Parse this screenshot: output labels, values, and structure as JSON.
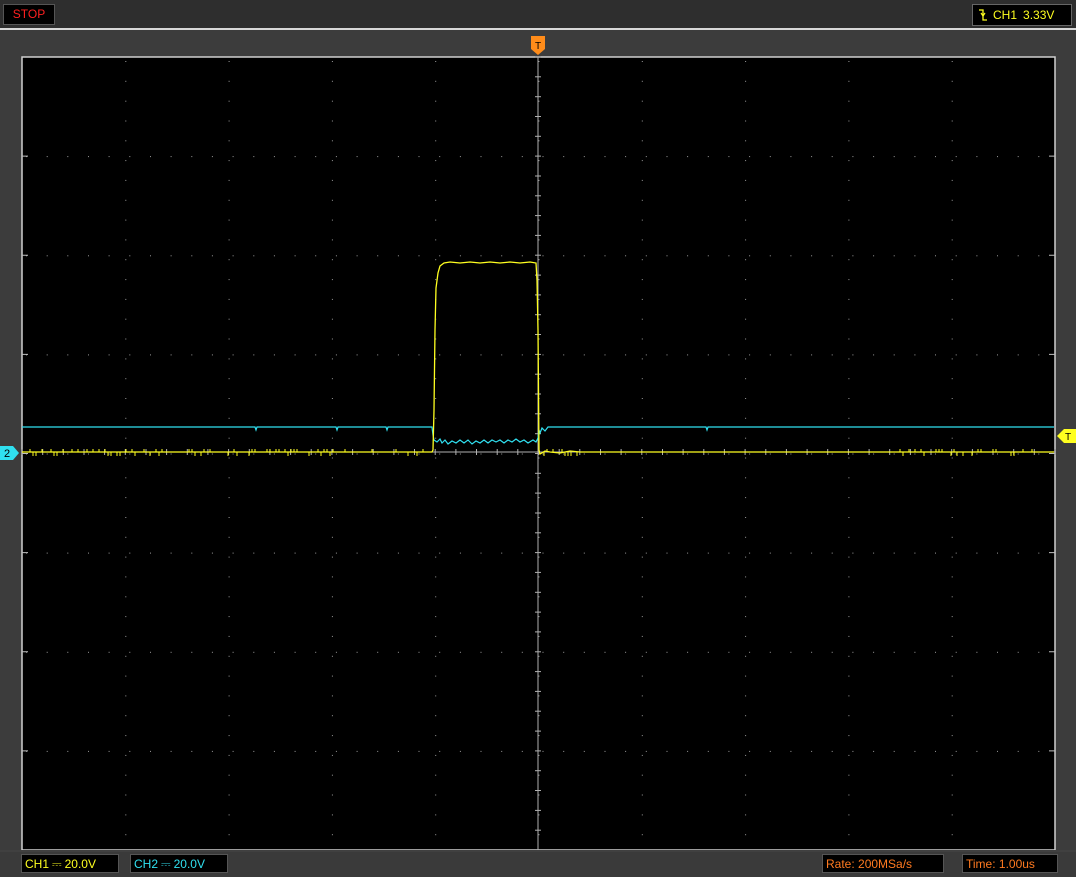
{
  "topbar": {
    "run_status": "STOP",
    "trigger_channel": "CH1",
    "trigger_level": "3.33V"
  },
  "markers": {
    "trigger_top": "T",
    "trigger_right": "T",
    "ch2_marker": "2"
  },
  "bottombar": {
    "ch1_label": "CH1",
    "ch1_coupling": "⎓",
    "ch1_scale": "20.0V",
    "ch2_label": "CH2",
    "ch2_coupling": "⎓",
    "ch2_scale": "20.0V",
    "rate": "Rate: 200MSa/s",
    "time": "Time: 1.00us"
  },
  "colors": {
    "ch1": "#ffff20",
    "ch2": "#30e0f0",
    "trigger": "#ff8c1a",
    "stop": "#ff2020",
    "grid": "#a0a0a0"
  }
}
